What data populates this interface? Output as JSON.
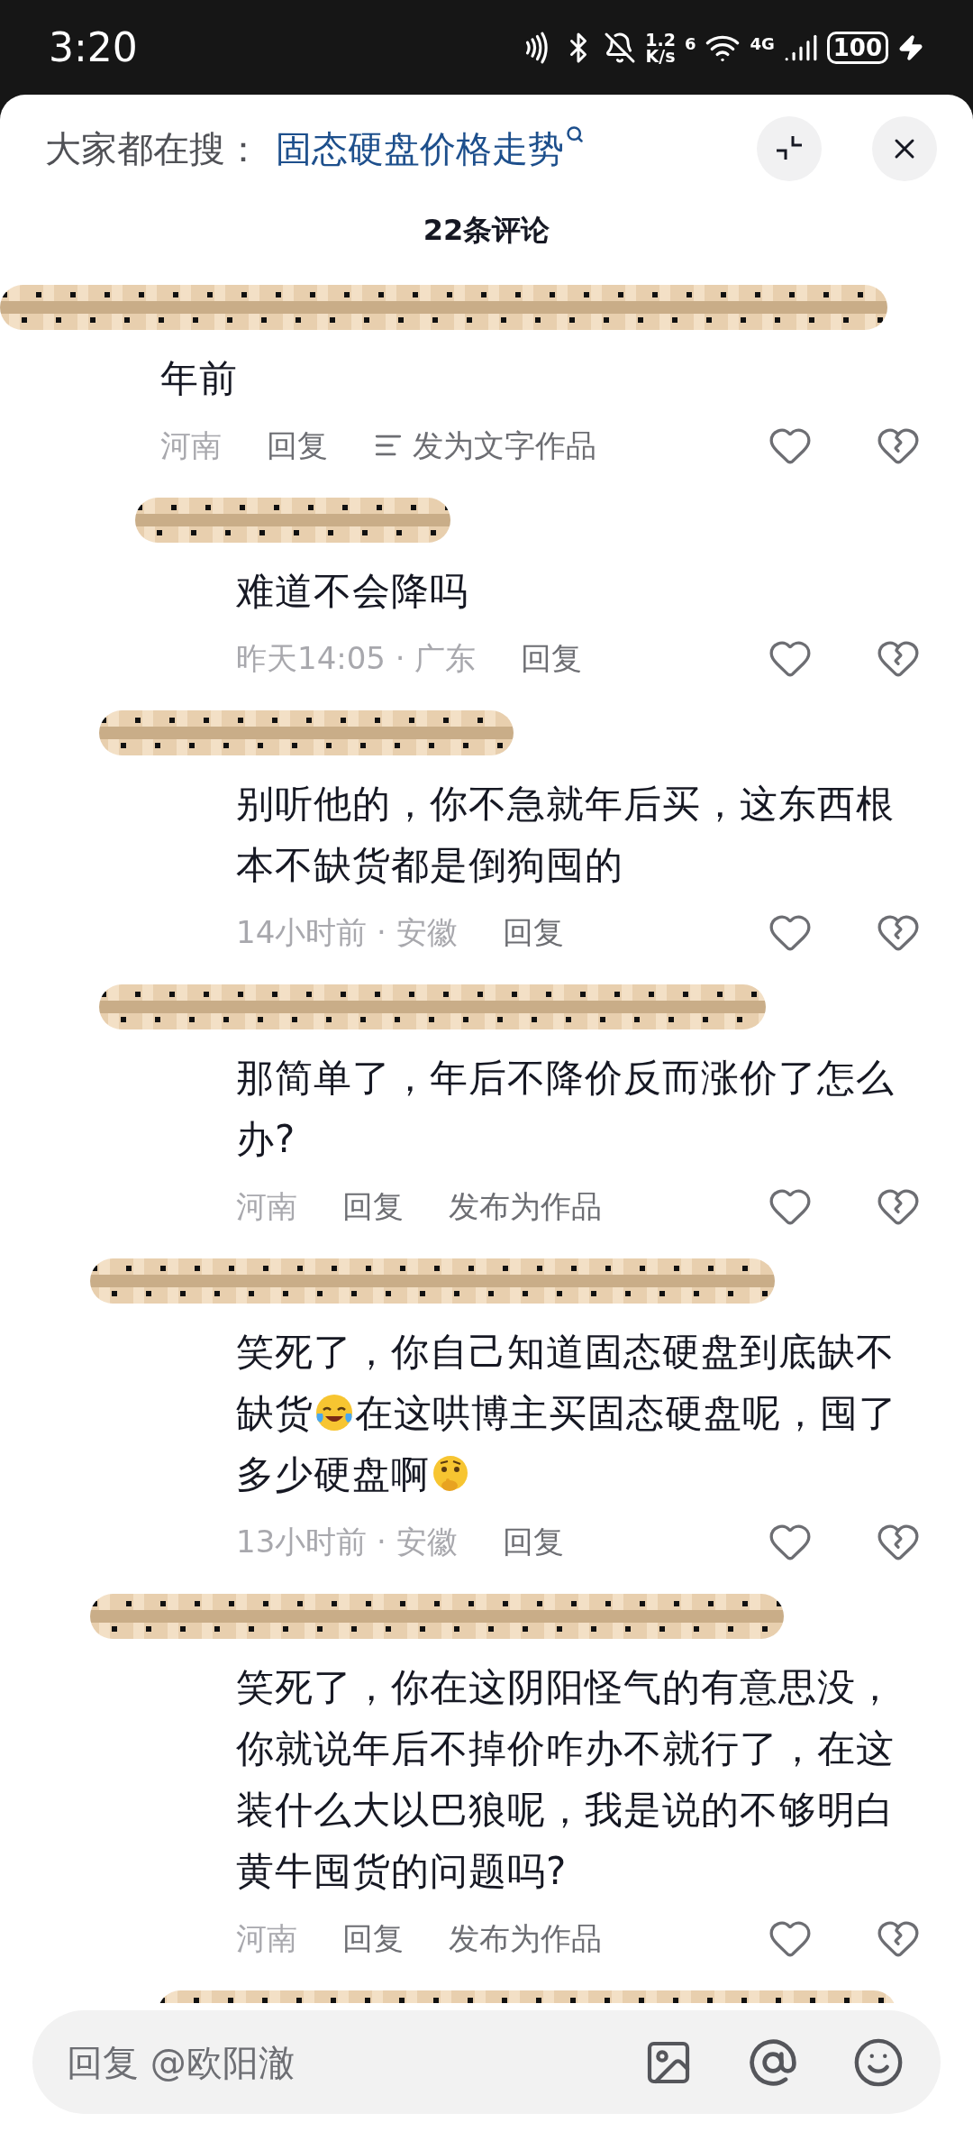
{
  "status_bar": {
    "time": "3:20",
    "speed_value": "1.2",
    "speed_unit": "K/s",
    "wifi_badge": "6",
    "network": "4G",
    "battery": "100"
  },
  "search_hint": {
    "label": "大家都在搜：",
    "query": "固态硬盘价格走势"
  },
  "title": "22条评论",
  "comments": [
    {
      "reply": false,
      "text": [
        {
          "kind": "text",
          "text": "年前"
        }
      ],
      "meta": "河南",
      "reply_label": "回复",
      "publish": {
        "label": "发为文字作品",
        "icon": true
      }
    },
    {
      "reply": true,
      "text": [
        {
          "kind": "text",
          "text": "难道不会降吗"
        }
      ],
      "meta": "昨天14:05 · 广东",
      "reply_label": "回复"
    },
    {
      "reply": true,
      "text": [
        {
          "kind": "text",
          "text": "别听他的，你不急就年后买，这东西根本不缺货都是倒狗囤的"
        }
      ],
      "meta": "14小时前 · 安徽",
      "reply_label": "回复"
    },
    {
      "reply": true,
      "text": [
        {
          "kind": "text",
          "text": "那简单了，年后不降价反而涨价了怎么办?"
        }
      ],
      "meta": "河南",
      "reply_label": "回复",
      "publish": {
        "label": "发布为作品",
        "icon": false
      }
    },
    {
      "reply": true,
      "text": [
        {
          "kind": "text",
          "text": "笑死了，你自己知道固态硬盘到底缺不缺货"
        },
        {
          "kind": "laugh"
        },
        {
          "kind": "text",
          "text": "在这哄博主买固态硬盘呢，囤了多少硬盘啊"
        },
        {
          "kind": "think"
        }
      ],
      "meta": "13小时前 · 安徽",
      "reply_label": "回复"
    },
    {
      "reply": true,
      "text": [
        {
          "kind": "text",
          "text": "笑死了，你在这阴阳怪气的有意思没，你就说年后不掉价咋办不就行了，在这装什么大以巴狼呢，我是说的不够明白黄牛囤货的问题吗?"
        }
      ],
      "meta": "河南",
      "reply_label": "回复",
      "publish": {
        "label": "发布为作品",
        "icon": false
      }
    }
  ],
  "input": {
    "placeholder": "回复 @欧阳澈"
  }
}
